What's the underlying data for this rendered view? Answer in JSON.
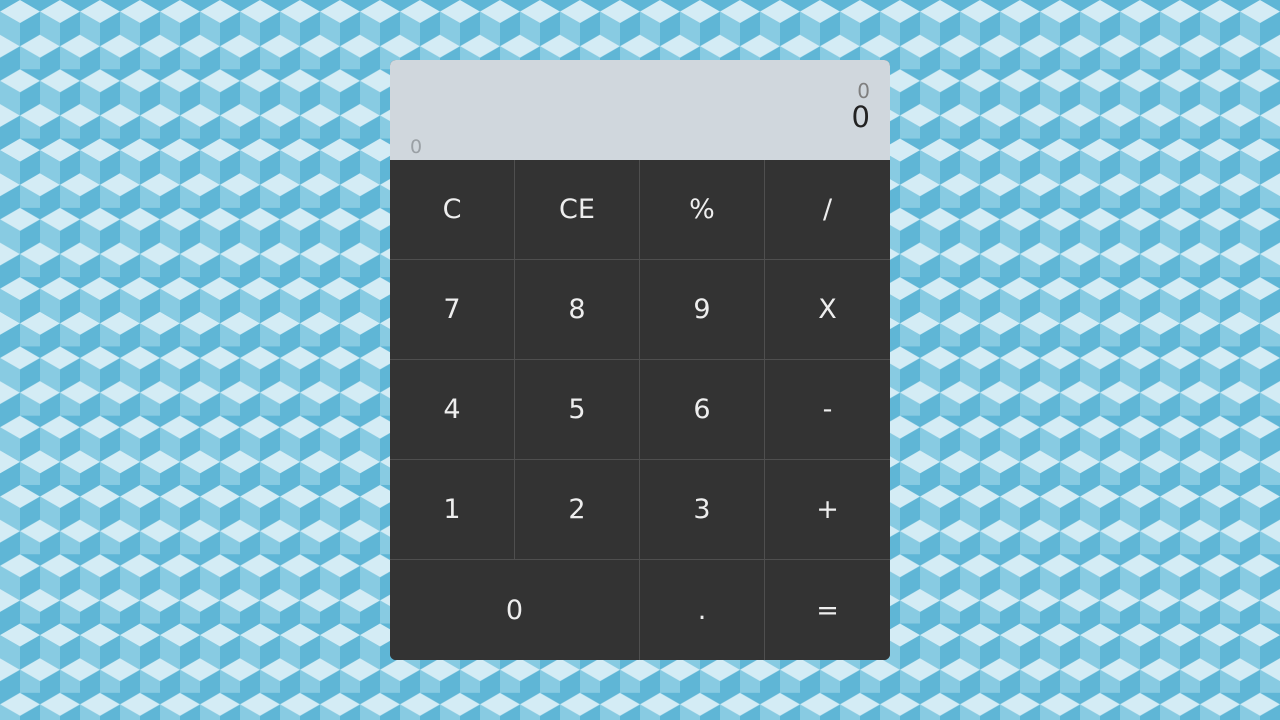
{
  "background": {
    "pattern": "isometric-cubes",
    "colors": {
      "light": "#d4ecf5",
      "mid": "#88cbe2",
      "dark": "#5fb6d6"
    }
  },
  "display": {
    "history": "0",
    "current": "0",
    "memory": "0"
  },
  "keys": [
    [
      "C",
      "CE",
      "%",
      "/"
    ],
    [
      "7",
      "8",
      "9",
      "X"
    ],
    [
      "4",
      "5",
      "6",
      "-"
    ],
    [
      "1",
      "2",
      "3",
      "+"
    ],
    [
      "0",
      ".",
      "="
    ]
  ]
}
